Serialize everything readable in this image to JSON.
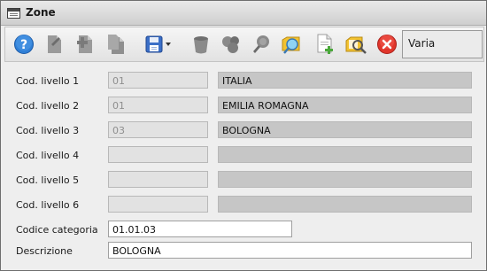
{
  "window": {
    "title": "Zone"
  },
  "toolbar": {
    "buttons": [
      {
        "name": "help-button",
        "icon": "help-icon"
      },
      {
        "name": "new-document-button",
        "icon": "document-icon"
      },
      {
        "name": "new-child-document-button",
        "icon": "document-add-icon"
      },
      {
        "name": "copy-document-button",
        "icon": "document-copy-icon"
      },
      {
        "name": "save-button",
        "icon": "floppy-disk-icon"
      },
      {
        "name": "delete-button",
        "icon": "trash-icon"
      },
      {
        "name": "group-button",
        "icon": "cluster-icon"
      },
      {
        "name": "search-button",
        "icon": "magnifier-icon"
      },
      {
        "name": "browse-button",
        "icon": "folder-search-icon"
      },
      {
        "name": "add-record-button",
        "icon": "add-page-icon"
      },
      {
        "name": "find-record-button",
        "icon": "folder-magnifier-icon"
      },
      {
        "name": "close-button",
        "icon": "close-circle-icon"
      }
    ],
    "mode_label": "Varia"
  },
  "form": {
    "levels": [
      {
        "label": "Cod. livello 1",
        "code": "01",
        "description": "ITALIA"
      },
      {
        "label": "Cod. livello 2",
        "code": "01",
        "description": "EMILIA ROMAGNA"
      },
      {
        "label": "Cod. livello 3",
        "code": "03",
        "description": "BOLOGNA"
      },
      {
        "label": "Cod. livello 4",
        "code": "",
        "description": ""
      },
      {
        "label": "Cod. livello 5",
        "code": "",
        "description": ""
      },
      {
        "label": "Cod. livello 6",
        "code": "",
        "description": ""
      }
    ],
    "category_label": "Codice categoria",
    "category_value": "01.01.03",
    "description_label": "Descrizione",
    "description_value": "BOLOGNA"
  },
  "colors": {
    "help_blue": "#2f7fd6",
    "save_blue": "#3b6fc7",
    "close_red": "#e0352b",
    "folder_yellow": "#f2c230",
    "disabled_gray": "#8c8c8c"
  }
}
